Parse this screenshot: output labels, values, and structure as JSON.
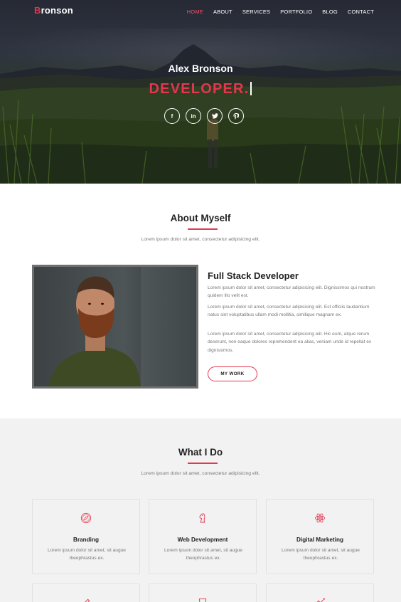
{
  "brand": {
    "first_letter": "B",
    "rest": "ronson"
  },
  "nav": {
    "items": [
      {
        "label": "HOME",
        "active": true
      },
      {
        "label": "ABOUT",
        "active": false
      },
      {
        "label": "SERVICES",
        "active": false
      },
      {
        "label": "PORTFOLIO",
        "active": false
      },
      {
        "label": "BLOG",
        "active": false
      },
      {
        "label": "CONTACT",
        "active": false
      }
    ]
  },
  "hero": {
    "name": "Alex Bronson",
    "role": "DEVELOPER.",
    "socials": [
      {
        "icon": "facebook-icon",
        "glyph": "f"
      },
      {
        "icon": "linkedin-icon",
        "glyph": "in"
      },
      {
        "icon": "twitter-icon",
        "glyph": "t"
      },
      {
        "icon": "pinterest-icon",
        "glyph": "p"
      }
    ]
  },
  "about": {
    "title": "About Myself",
    "subtitle": "Lorem ipsum dolor sit amet, consectetur adipisicing elit.",
    "heading": "Full Stack Developer",
    "paragraphs": [
      "Lorem ipsum dolor sit amet, consectetur adipisicing elit. Dignissimos qui nostrum quidem illo velit est.",
      "Lorem ipsum dolor sit amet, consectetur adipisicing elit. Est officiis laudantium natus sint voluptatibus ullam modi mollitia, similique magnam ex.",
      "Lorem ipsum dolor sit amet, consectetur adipisicing elit. Hic eum, atque rerum deserunt, non eaque dolores reprehenderit ea alias, veniam unde id repellat ex dignissimos."
    ],
    "button_label": "MY WORK"
  },
  "services": {
    "title": "What I Do",
    "subtitle": "Lorem ipsum dolor sit amet, consectetur adipisicing elit.",
    "cards": [
      {
        "icon": "compass-icon",
        "title": "Branding",
        "desc": "Lorem ipsum dolor sit amet, sit augue theophrastus ex."
      },
      {
        "icon": "chess-knight-icon",
        "title": "Web Development",
        "desc": "Lorem ipsum dolor sit amet, sit augue theophrastus ex."
      },
      {
        "icon": "atom-icon",
        "title": "Digital Marketing",
        "desc": "Lorem ipsum dolor sit amet, sit augue theophrastus ex."
      }
    ]
  },
  "colors": {
    "accent": "#e3364f",
    "text": "#222222",
    "muted": "#777777",
    "section_bg": "#f2f2f2"
  }
}
